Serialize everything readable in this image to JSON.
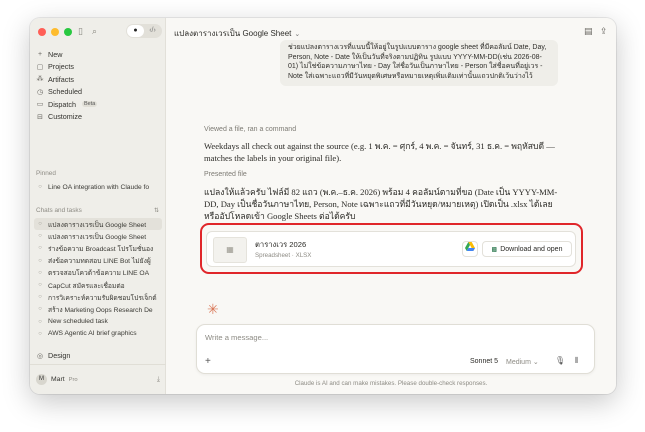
{
  "sidebar": {
    "nav": [
      {
        "icon": "plus-icon",
        "glyph": "+",
        "label": "New"
      },
      {
        "icon": "folder-icon",
        "glyph": "▢",
        "label": "Projects"
      },
      {
        "icon": "artifacts-icon",
        "glyph": "⁂",
        "label": "Artifacts"
      },
      {
        "icon": "clock-icon",
        "glyph": "◷",
        "label": "Scheduled"
      },
      {
        "icon": "dispatch-icon",
        "glyph": "▭",
        "label": "Dispatch",
        "badge": "Beta"
      },
      {
        "icon": "customize-icon",
        "glyph": "⊟",
        "label": "Customize"
      }
    ],
    "pinned_label": "Pinned",
    "pinned": [
      {
        "label": "Line OA integration with Claude fo"
      }
    ],
    "chats_label": "Chats and tasks",
    "chats": [
      {
        "label": "แปลงตารางเวรเป็น Google Sheet",
        "active": true
      },
      {
        "label": "แปลงตารางเวรเป็น Google Sheet",
        "active": false
      },
      {
        "label": "ร่างข้อความ Broadcast โปรโมชั่นอง",
        "active": false
      },
      {
        "label": "ส่งข้อความทดสอบ LINE Bot ไม่ยังผู้",
        "active": false
      },
      {
        "label": "ตรวจสอบโควต้าข้อความ LINE OA",
        "active": false
      },
      {
        "label": "CapCut สมัครและเชื่อมต่อ",
        "active": false
      },
      {
        "label": "การวิเคราะห์ความรับผิดชอบโปรเจ็กต์",
        "active": false
      },
      {
        "label": "สร้าง Marketing Oops Research De",
        "active": false
      },
      {
        "label": "New scheduled task",
        "active": false
      },
      {
        "label": "AWS Agentic AI brief graphics",
        "active": false
      }
    ],
    "design_label": "Design",
    "user": {
      "initial": "M",
      "name": "Mart",
      "plan": "Pro"
    }
  },
  "header": {
    "title": "แปลงตารางเวรเป็น Google Sheet"
  },
  "chat": {
    "user_message": "ช่วยแปลงตารางเวรที่แนบนี้ให้อยู่ในรูปแบบตาราง google sheet ที่มีคอลัมน์ Date, Day, Person, Note - Date ให้เป็นวันที่จริงตามปฏิทิน รูปแบบ YYYY-MM-DD(เช่น 2026-08-01) ไม่ใช่ข้อความภาษาไทย - Day ใส่ชื่อวันเป็นภาษาไทย - Person ใส่ชื่อคนที่อยู่เวร - Note ใส่เฉพาะแถวที่มีวันหยุดพิเศษหรือหมายเหตุเพิ่มเติมเท่านั้นแถวปกติเว้นว่างไว้",
    "viewed_label": "Viewed a file, ran a command",
    "assistant_para1": "Weekdays all check out against the source (e.g. 1 พ.ค. = ศุกร์, 4 พ.ค. = จันทร์, 31 ธ.ค. = พฤหัสบดี — matches the labels in your original file).",
    "presented_label": "Presented file",
    "assistant_para2": "แปลงให้แล้วครับ ไฟล์มี 82 แถว (พ.ค.–ธ.ค. 2026) พร้อม 4 คอลัมน์ตามที่ขอ (Date เป็น YYYY-MM-DD, Day เป็นชื่อวันภาษาไทย, Person, Note เฉพาะแถวที่มีวันหยุด/หมายเหตุ) เปิดเป็น .xlsx ได้เลย หรืออัปโหลดเข้า Google Sheets ต่อได้ครับ",
    "file": {
      "name": "ตารางเวร 2026",
      "type": "Spreadsheet · XLSX",
      "download_label": "Download and open"
    }
  },
  "composer": {
    "placeholder": "Write a message...",
    "model": "Sonnet 5",
    "effort": "Medium"
  },
  "disclaimer": "Claude is AI and can make mistakes. Please double-check responses.",
  "colors": {
    "highlight": "#e0262a",
    "accent_spark": "#d97757"
  }
}
